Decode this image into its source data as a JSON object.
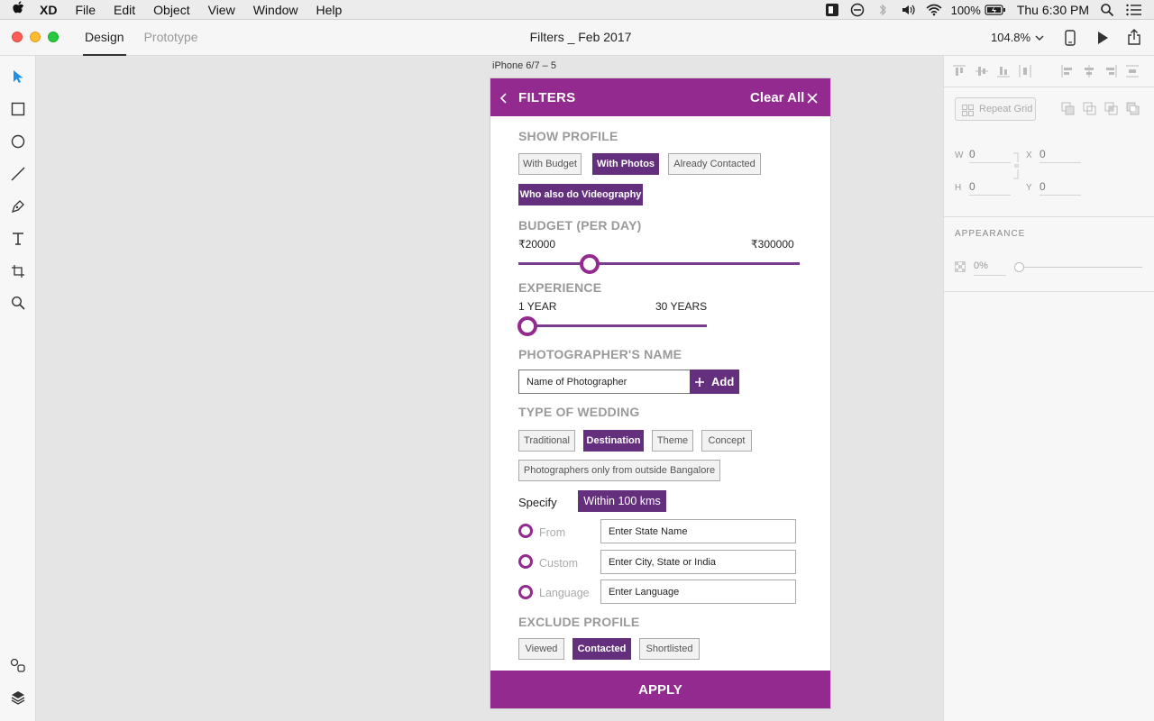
{
  "menubar": {
    "apple_icon": "apple-icon",
    "app_name": "XD",
    "items": [
      "File",
      "Edit",
      "Object",
      "View",
      "Window",
      "Help"
    ],
    "battery": "100%",
    "clock": "Thu 6:30 PM"
  },
  "titlebar": {
    "tabs": [
      "Design",
      "Prototype"
    ],
    "active_tab": "Design",
    "document_title": "Filters _ Feb 2017",
    "zoom": "104.8%"
  },
  "right_panel": {
    "repeat_grid_label": "Repeat Grid",
    "w_label": "W",
    "w_value": "0",
    "x_label": "X",
    "x_value": "0",
    "h_label": "H",
    "h_value": "0",
    "y_label": "Y",
    "y_value": "0",
    "appearance_title": "APPEARANCE",
    "opacity_value": "0%"
  },
  "artboard": {
    "name": "iPhone 6/7 – 5",
    "header": {
      "title": "FILTERS",
      "clear_all": "Clear All"
    },
    "show_profile": {
      "title": "SHOW PROFILE",
      "chips": [
        {
          "label": "With Budget",
          "selected": false
        },
        {
          "label": "With Photos",
          "selected": true
        },
        {
          "label": "Already Contacted",
          "selected": false
        },
        {
          "label": "Who also do Videography",
          "selected": true
        }
      ]
    },
    "budget": {
      "title": "BUDGET (PER DAY)",
      "min_label": "20000",
      "max_label": "300000",
      "currency_symbol": "₹"
    },
    "experience": {
      "title": "EXPERIENCE",
      "min_label": "1 YEAR",
      "max_label": "30 YEARS"
    },
    "photographer_name": {
      "title": "PHOTOGRAPHER'S NAME",
      "placeholder": "Name of Photographer",
      "add_label": "Add"
    },
    "type_of_wedding": {
      "title": "TYPE OF WEDDING",
      "chips": [
        {
          "label": "Traditional",
          "selected": false
        },
        {
          "label": "Destination",
          "selected": true
        },
        {
          "label": "Theme",
          "selected": false
        },
        {
          "label": "Concept",
          "selected": false
        },
        {
          "label": "Photographers only from outside Bangalore",
          "selected": false
        }
      ]
    },
    "specify": {
      "label": "Specify",
      "within_label": "Within 100 kms",
      "options": [
        {
          "label": "From",
          "input": "Enter State Name"
        },
        {
          "label": "Custom",
          "input": "Enter City, State or India"
        },
        {
          "label": "Language",
          "input": "Enter Language"
        }
      ]
    },
    "exclude_profile": {
      "title": "EXCLUDE PROFILE",
      "chips": [
        {
          "label": "Viewed",
          "selected": false
        },
        {
          "label": "Contacted",
          "selected": true
        },
        {
          "label": "Shortlisted",
          "selected": false
        }
      ]
    },
    "apply_label": "APPLY"
  },
  "colors": {
    "brand_purple": "#922a8f",
    "selected_purple": "#64307d"
  }
}
